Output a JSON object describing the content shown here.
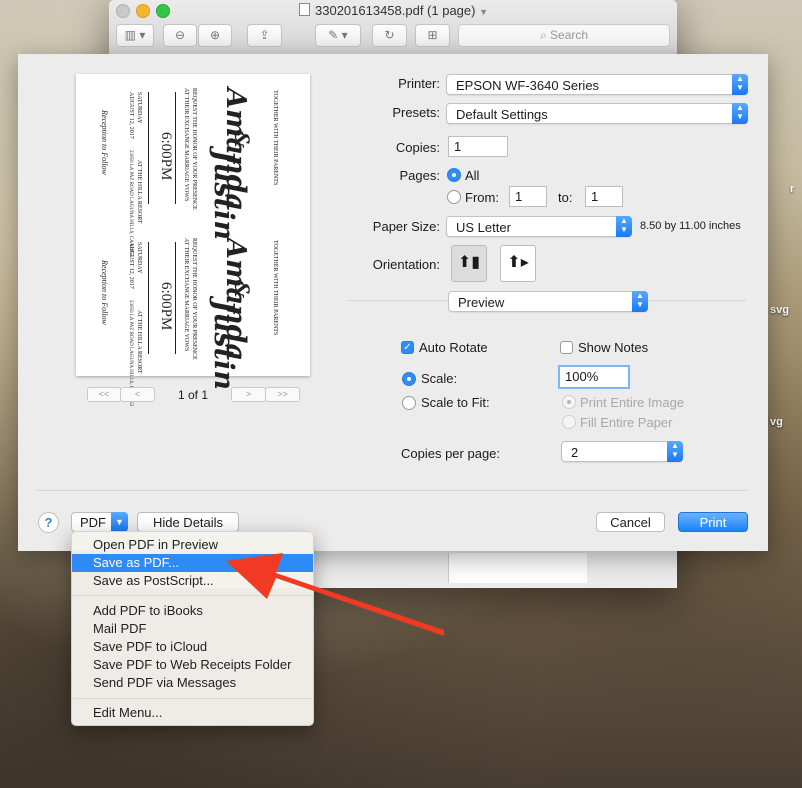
{
  "window": {
    "title": "330201613458.pdf (1 page)",
    "search_placeholder": "Search"
  },
  "desktop": {
    "labels": [
      "r",
      "svg",
      "vg"
    ]
  },
  "preview_card": {
    "top_line": "TOGETHER WITH THEIR PARENTS",
    "request_1": "REQUEST THE HONOR OF YOUR PRESENCE",
    "request_2": "AT THEIR EXCHANGE MARRIAGE VOWS",
    "name1": "Amanda",
    "amp": "&",
    "name2": "Justin",
    "day": "SATURDAY",
    "date": "AUGUST 12, 2017",
    "time": "6:00PM",
    "place": "AT THE HILLA RESORT",
    "address_1": "23050 LA PAZ ROAD LAGUNA HILLS, CA 92653",
    "reception": "Reception to Follow"
  },
  "pager": {
    "first": "<<",
    "prev": "<",
    "next": ">",
    "last": ">>",
    "text": "1 of 1"
  },
  "form": {
    "printer_label": "Printer:",
    "printer_value": "EPSON WF-3640 Series",
    "presets_label": "Presets:",
    "presets_value": "Default Settings",
    "copies_label": "Copies:",
    "copies_value": "1",
    "pages_label": "Pages:",
    "pages_all": "All",
    "pages_from": "From:",
    "from_value": "1",
    "to_label": "to:",
    "to_value": "1",
    "paper_label": "Paper Size:",
    "paper_value": "US Letter",
    "paper_dims": "8.50 by 11.00 inches",
    "orientation_label": "Orientation:",
    "section_value": "Preview",
    "auto_rotate": "Auto Rotate",
    "show_notes": "Show Notes",
    "scale_label": "Scale:",
    "scale_value": "100%",
    "scale_fit": "Scale to Fit:",
    "print_entire": "Print Entire Image",
    "fill_entire": "Fill Entire Paper",
    "copies_per_page_label": "Copies per page:",
    "copies_per_page_value": "2"
  },
  "footer": {
    "help": "?",
    "pdf": "PDF",
    "hide_details": "Hide Details",
    "cancel": "Cancel",
    "print": "Print"
  },
  "menu": {
    "items": [
      "Open PDF in Preview",
      "Save as PDF...",
      "Save as PostScript...",
      "Add PDF to iBooks",
      "Mail PDF",
      "Save PDF to iCloud",
      "Save PDF to Web Receipts Folder",
      "Send PDF via Messages",
      "Edit Menu..."
    ],
    "selected": "Save as PDF..."
  },
  "colors": {
    "accent": "#2e8af5",
    "arrow": "#f03a24"
  }
}
